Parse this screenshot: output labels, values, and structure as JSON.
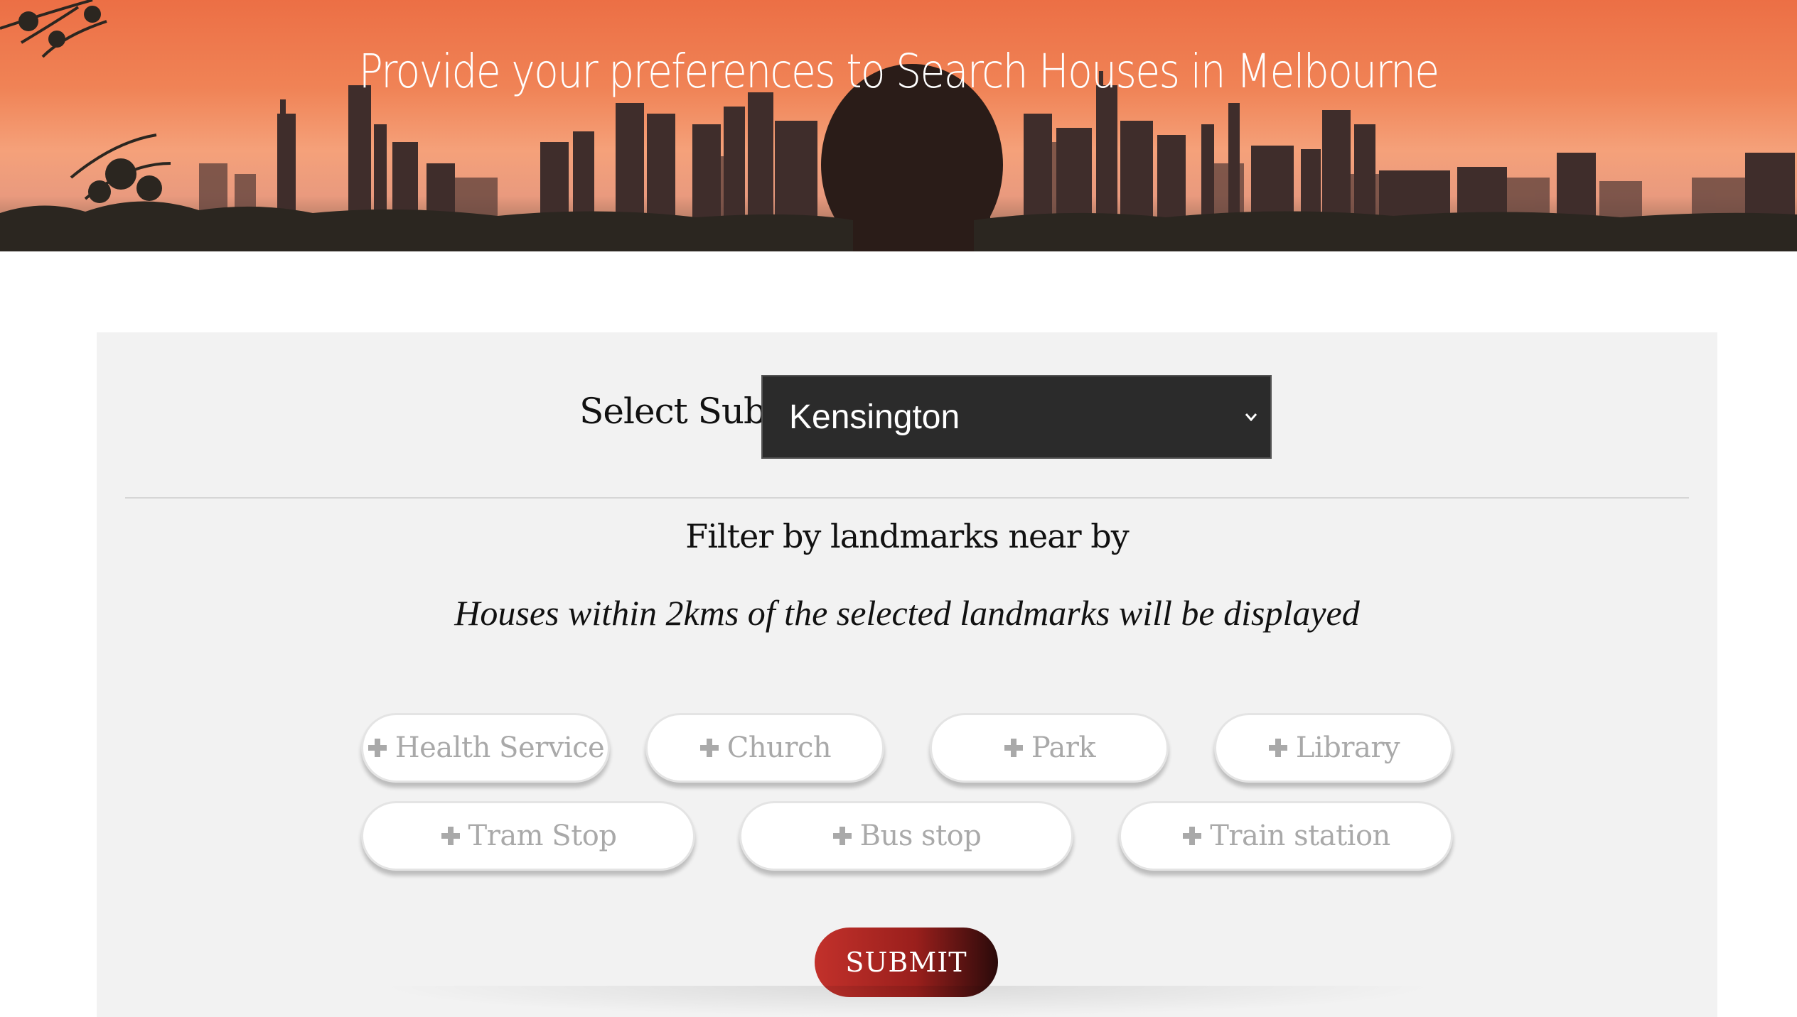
{
  "hero": {
    "title": "Provide your preferences to Search Houses in Melbourne"
  },
  "form": {
    "suburb_label": "Select Suburb:",
    "suburb_selected": "Kensington",
    "filter_title": "Filter by landmarks near by",
    "filter_subtitle": "Houses within 2kms of the selected landmarks will be displayed",
    "landmarks": [
      "Health Service",
      "Church",
      "Park",
      "Library",
      "Tram Stop",
      "Bus stop",
      "Train station"
    ],
    "submit_label": "SUBMIT"
  },
  "colors": {
    "card_background": "#f2f2f2",
    "select_background": "#2b2b2b",
    "chip_text": "#a9a9a9",
    "submit_start": "#c2312b",
    "submit_end": "#2a0a0a"
  },
  "icons": {
    "chip_icon": "plus-icon",
    "select_icon": "chevron-down-icon"
  }
}
